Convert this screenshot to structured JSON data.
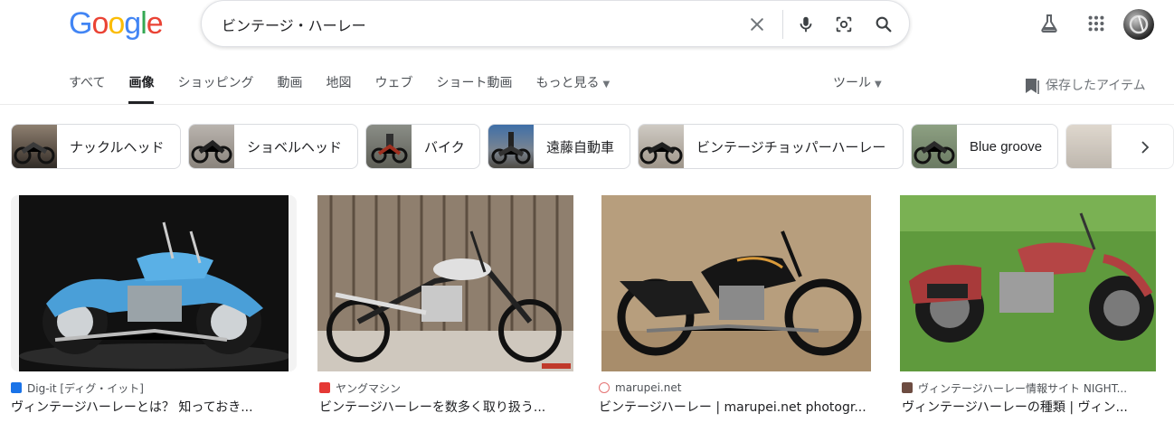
{
  "logo": {
    "letters": [
      "G",
      "o",
      "o",
      "g",
      "l",
      "e"
    ]
  },
  "search": {
    "query": "ビンテージ・ハーレー"
  },
  "icons": {
    "clear": "close-icon",
    "voice": "microphone-icon",
    "lens": "camera-lens-icon",
    "search": "search-icon",
    "labs": "flask-icon",
    "apps": "apps-grid-icon"
  },
  "tabs": [
    "すべて",
    "画像",
    "ショッピング",
    "動画",
    "地図",
    "ウェブ",
    "ショート動画",
    "もっと見る"
  ],
  "active_tab": "画像",
  "tools_label": "ツール",
  "saved_label": "保存したアイテム",
  "chips": [
    {
      "label": "ナックルヘッド"
    },
    {
      "label": "ショベルヘッド"
    },
    {
      "label": "バイク"
    },
    {
      "label": "遠藤自動車"
    },
    {
      "label": "ビンテージチョッパーハーレー"
    },
    {
      "label": "Blue groove"
    }
  ],
  "results": [
    {
      "source": "Dig-it [ディグ・イット]",
      "title": "ヴィンテージハーレーとは？ 知っておき..."
    },
    {
      "source": "ヤングマシン",
      "title": "ビンテージハーレーを数多く取り扱う..."
    },
    {
      "source": "marupei.net",
      "title": "ビンテージハーレー | marupei.net photogr..."
    },
    {
      "source": "ヴィンテージハーレー情報サイト NIGHT...",
      "title": "ヴィンテージハーレーの種類 | ヴィン..."
    }
  ],
  "colors": {
    "blue": "#4285f4",
    "red": "#ea4335",
    "yellow": "#fbbc05",
    "green": "#34a853"
  }
}
